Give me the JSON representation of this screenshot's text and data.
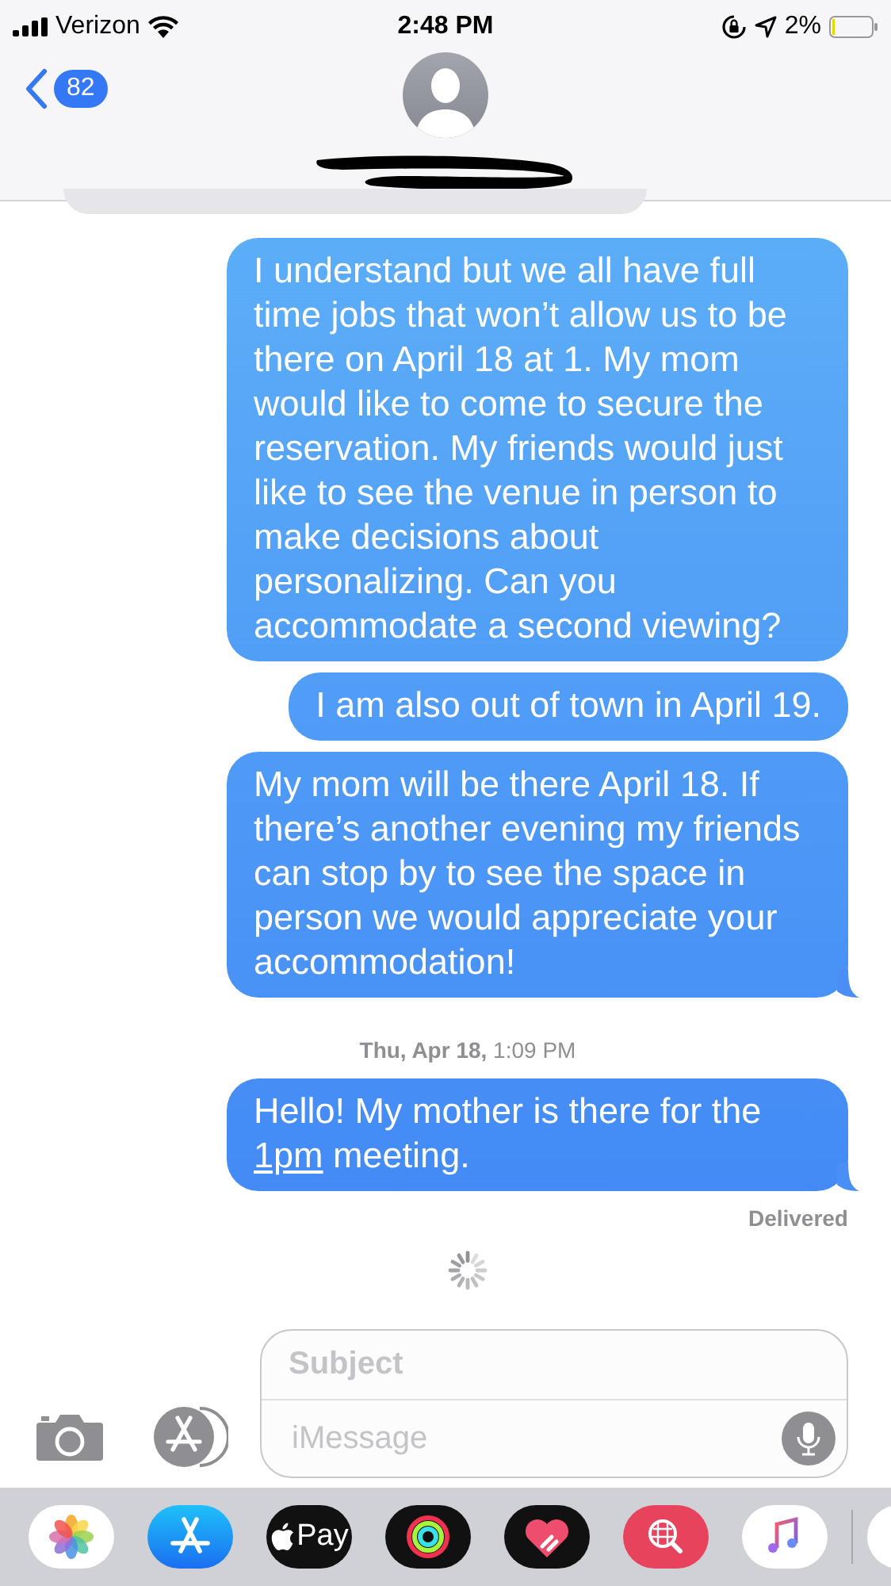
{
  "status_bar": {
    "carrier": "Verizon",
    "time": "2:48 PM",
    "battery": "2%"
  },
  "nav": {
    "back_count": "82"
  },
  "messages": [
    {
      "kind": "sent",
      "parts": [
        {
          "text": "I understand but we all have full time jobs that won’t allow us to be there on April 18 at 1. My mom would like to come to secure the reservation. My friends would just like to see the venue in person to make decisions about personalizing. Can you accommodate a second viewing?"
        }
      ],
      "tail": false
    },
    {
      "kind": "sent",
      "parts": [
        {
          "text": "I am also out of town in April 19."
        }
      ],
      "tail": false
    },
    {
      "kind": "sent",
      "parts": [
        {
          "text": "My mom will be there April 18. If there’s another evening my friends can stop by to see the space in person we would appreciate your accommodation!"
        }
      ],
      "tail": true
    },
    {
      "kind": "timestamp",
      "day": "Thu, Apr 18,",
      "time": "1:09 PM"
    },
    {
      "kind": "sent",
      "parts": [
        {
          "text": "Hello! My mother is there for the "
        },
        {
          "text": "1pm",
          "kind": "link"
        },
        {
          "text": " meeting."
        }
      ],
      "tail": true
    },
    {
      "kind": "status",
      "text": "Delivered"
    }
  ],
  "composer": {
    "subject_placeholder": "Subject",
    "message_placeholder": "iMessage"
  },
  "dock": [
    {
      "kind": "photos"
    },
    {
      "kind": "appstore"
    },
    {
      "kind": "pay",
      "label": "Pay"
    },
    {
      "kind": "activity"
    },
    {
      "kind": "heart"
    },
    {
      "kind": "search"
    },
    {
      "kind": "music"
    }
  ]
}
